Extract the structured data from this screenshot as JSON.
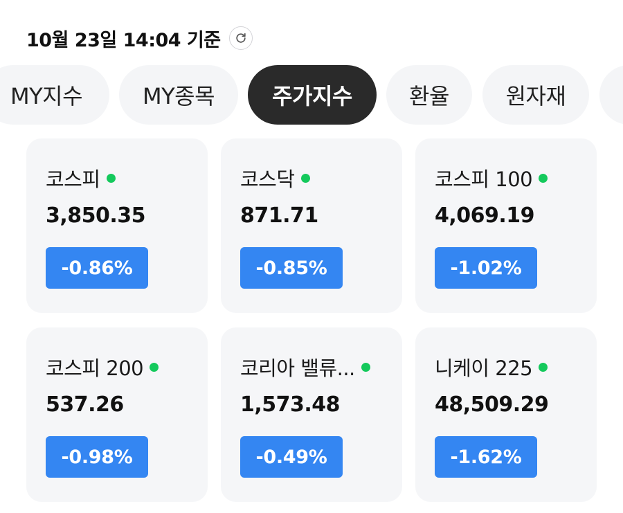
{
  "header": {
    "timestamp": "10월 23일 14:04 기준",
    "refresh_icon": "refresh-icon"
  },
  "tabs": [
    {
      "label": "MY지수",
      "active": false
    },
    {
      "label": "MY종목",
      "active": false
    },
    {
      "label": "주가지수",
      "active": true
    },
    {
      "label": "환율",
      "active": false
    },
    {
      "label": "원자재",
      "active": false
    }
  ],
  "colors": {
    "accent_badge": "#3486f2",
    "live_dot": "#14c95c",
    "active_tab": "#2a2a2a",
    "card_bg": "#f5f6f8"
  },
  "indices": [
    {
      "name": "코스피",
      "value": "3,850.35",
      "change": "-0.86%"
    },
    {
      "name": "코스닥",
      "value": "871.71",
      "change": "-0.85%"
    },
    {
      "name": "코스피 100",
      "value": "4,069.19",
      "change": "-1.02%"
    },
    {
      "name": "코스피 200",
      "value": "537.26",
      "change": "-0.98%"
    },
    {
      "name": "코리아 밸류...",
      "value": "1,573.48",
      "change": "-0.49%"
    },
    {
      "name": "니케이 225",
      "value": "48,509.29",
      "change": "-1.62%"
    }
  ]
}
